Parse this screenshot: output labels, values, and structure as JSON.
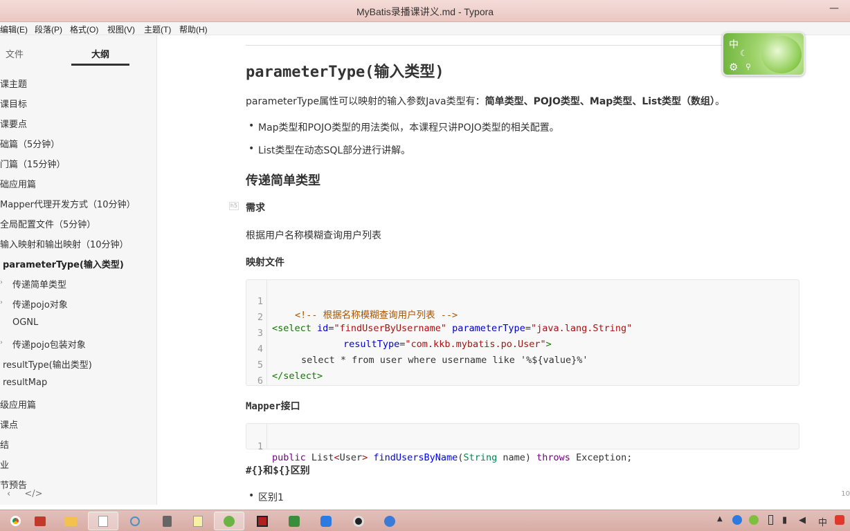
{
  "window": {
    "title": "MyBatis录播课讲义.md - Typora",
    "min_glyph": "—"
  },
  "menu": [
    "编辑(E)",
    "段落(P)",
    "格式(O)",
    "视图(V)",
    "主题(T)",
    "帮助(H)"
  ],
  "sidebar": {
    "tabs": [
      "文件",
      "大纲"
    ],
    "outline": [
      {
        "label": "课主题",
        "expander": false,
        "active": false
      },
      {
        "label": "课目标",
        "expander": false,
        "active": false
      },
      {
        "label": "课要点",
        "expander": false,
        "active": false
      },
      {
        "label": "础篇（5分钟）",
        "expander": false,
        "active": false
      },
      {
        "label": "门篇（15分钟）",
        "expander": false,
        "active": false
      },
      {
        "label": "础应用篇",
        "expander": false,
        "active": false
      },
      {
        "label": "Mapper代理开发方式（10分钟）",
        "expander": false,
        "active": false
      },
      {
        "label": "全局配置文件（5分钟）",
        "expander": false,
        "active": false
      },
      {
        "label": "输入映射和输出映射（10分钟）",
        "expander": false,
        "active": false
      },
      {
        "label": "parameterType(输入类型)",
        "expander": false,
        "active": true
      },
      {
        "label": "传递简单类型",
        "expander": true,
        "active": false
      },
      {
        "label": "传递pojo对象",
        "expander": true,
        "active": false
      },
      {
        "label": "OGNL",
        "expander": false,
        "active": false
      },
      {
        "label": "传递pojo包装对象",
        "expander": true,
        "active": false
      },
      {
        "label": "resultType(输出类型)",
        "expander": false,
        "active": false
      },
      {
        "label": "resultMap",
        "expander": false,
        "active": false
      },
      {
        "label": "级应用篇",
        "expander": false,
        "active": false
      },
      {
        "label": "课点",
        "expander": false,
        "active": false
      },
      {
        "label": "结",
        "expander": false,
        "active": false
      },
      {
        "label": "业",
        "expander": false,
        "active": false
      },
      {
        "label": "节预告",
        "expander": false,
        "active": false
      }
    ],
    "chev_glyph": "›",
    "footer_left": "‹",
    "footer_code": "</>"
  },
  "content": {
    "h2": "parameterType(输入类型)",
    "intro_plain": "parameterType属性可以映射的输入参数Java类型有：",
    "intro_bold": "简单类型、POJO类型、Map类型、List类型（数组）",
    "intro_end": "。",
    "bullets": [
      "Map类型和POJO类型的用法类似，本课程只讲POJO类型的相关配置。",
      "List类型在动态SQL部分进行讲解。"
    ],
    "h3": "传递简单类型",
    "h5_tag": "h5",
    "h5_need": "需求",
    "need_text": "根据用户名称模糊查询用户列表",
    "mapping_label": "映射文件",
    "code1": {
      "line_numbers": [
        "1",
        "2",
        "3",
        "4",
        "5",
        "6"
      ],
      "l1_comment": "<!-- 根据名称模糊查询用户列表 -->",
      "l2_open": "<select",
      "l2_attr1": "id",
      "l2_val1": "\"findUserByUsername\"",
      "l2_attr2": "parameterType",
      "l2_val2": "\"java.lang.String\"",
      "l3_attr": "resultType",
      "l3_val": "\"com.kkb.mybatis.po.User\"",
      "l3_close": ">",
      "l4": "select * from user where username like '%${value}%'",
      "l5": "</select>"
    },
    "mapper_label": "Mapper接口",
    "code2": {
      "line_number": "1",
      "kw_public": "public",
      "type_list": "List",
      "generic_open": "<",
      "generic_user": "User",
      "generic_close": ">",
      "fn": "findUsersByName",
      "paren_open": "(",
      "type_string": "String",
      "param": "name",
      "paren_close": ")",
      "kw_throws": "throws",
      "exc": "Exception;"
    },
    "diff_heading": "#{}和${}区别",
    "diff_bullet": "区别1",
    "right_number": "10"
  },
  "ime": {
    "label": "中",
    "moon": "☾",
    "gear": "⚙",
    "pin": "⚲"
  },
  "tray": {
    "lang": "中"
  }
}
